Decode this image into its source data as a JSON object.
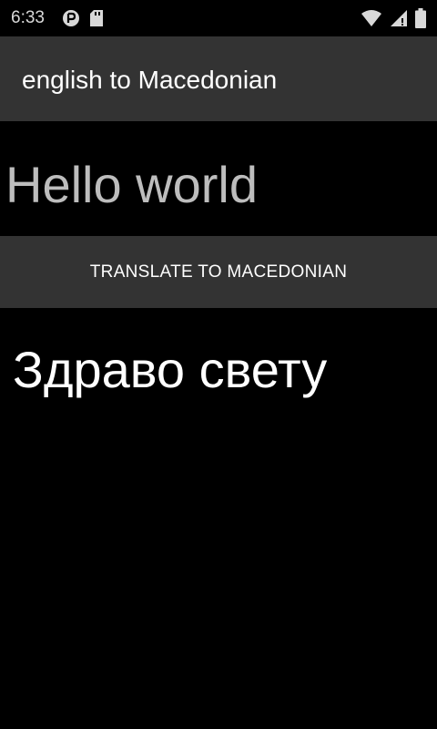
{
  "status_bar": {
    "time": "6:33",
    "icons": [
      "sync-icon",
      "sd-card-icon",
      "wifi-icon",
      "cellular-signal-icon",
      "battery-icon"
    ]
  },
  "app_bar": {
    "title": "english to Macedonian"
  },
  "input": {
    "value": "Hello world"
  },
  "translate_button": {
    "label": "TRANSLATE TO MACEDONIAN"
  },
  "result": {
    "text": "Здраво свету"
  },
  "colors": {
    "background": "#000000",
    "app_bar": "#333333",
    "button": "#333333",
    "input_text": "#bdbdbd",
    "text": "#ffffff"
  }
}
